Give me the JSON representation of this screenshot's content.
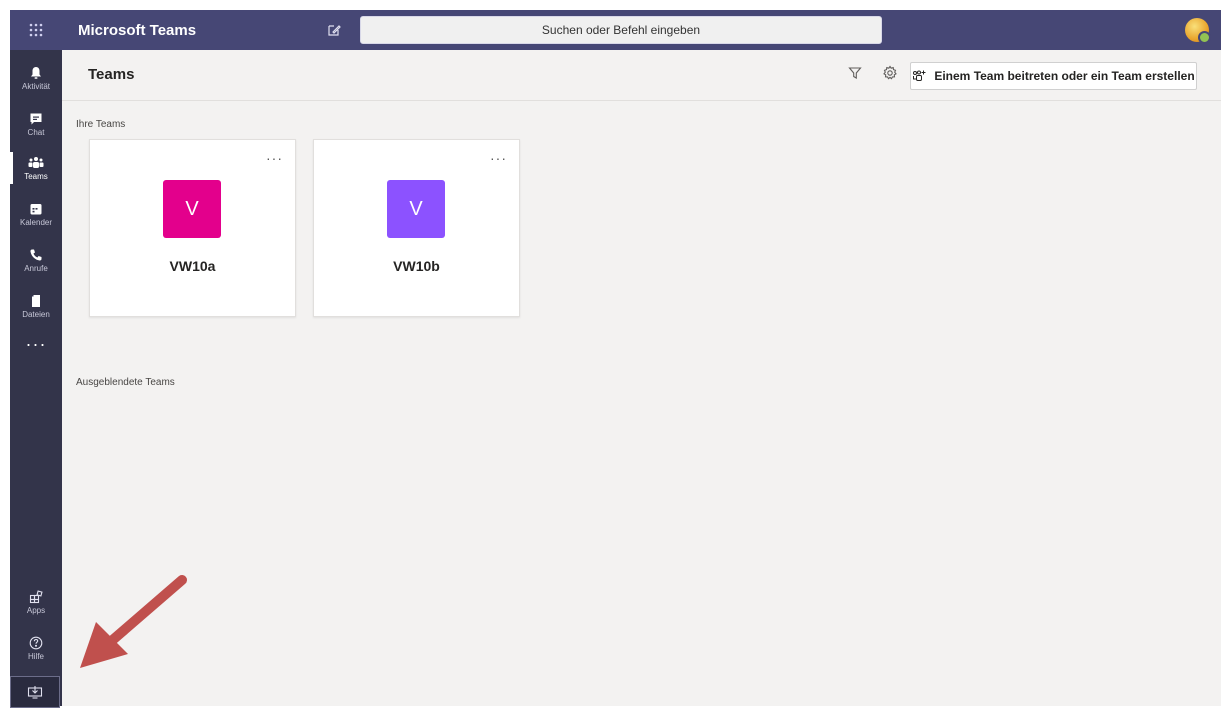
{
  "app": {
    "title": "Microsoft Teams",
    "search_placeholder": "Suchen oder Befehl eingeben"
  },
  "rail": {
    "items": [
      {
        "label": "Aktivität",
        "icon": "bell-icon"
      },
      {
        "label": "Chat",
        "icon": "chat-icon"
      },
      {
        "label": "Teams",
        "icon": "teams-icon",
        "active": true
      },
      {
        "label": "Kalender",
        "icon": "calendar-icon"
      },
      {
        "label": "Anrufe",
        "icon": "phone-icon"
      },
      {
        "label": "Dateien",
        "icon": "file-icon"
      }
    ],
    "more": "···",
    "bottom": [
      {
        "label": "Apps",
        "icon": "apps-icon"
      },
      {
        "label": "Hilfe",
        "icon": "help-icon"
      }
    ],
    "download_icon": "download-icon"
  },
  "header": {
    "title": "Teams",
    "join_button": "Einem Team beitreten oder ein Team erstellen"
  },
  "sections": {
    "your_teams": "Ihre Teams",
    "hidden_teams": "Ausgeblendete Teams"
  },
  "teams": [
    {
      "initial": "V",
      "name": "VW10a",
      "color": "#e3008c"
    },
    {
      "initial": "V",
      "name": "VW10b",
      "color": "#8c52ff"
    }
  ],
  "card_more": "···",
  "colors": {
    "topbar": "#464775",
    "rail": "#33344a",
    "annotation_arrow": "#c0504d"
  }
}
